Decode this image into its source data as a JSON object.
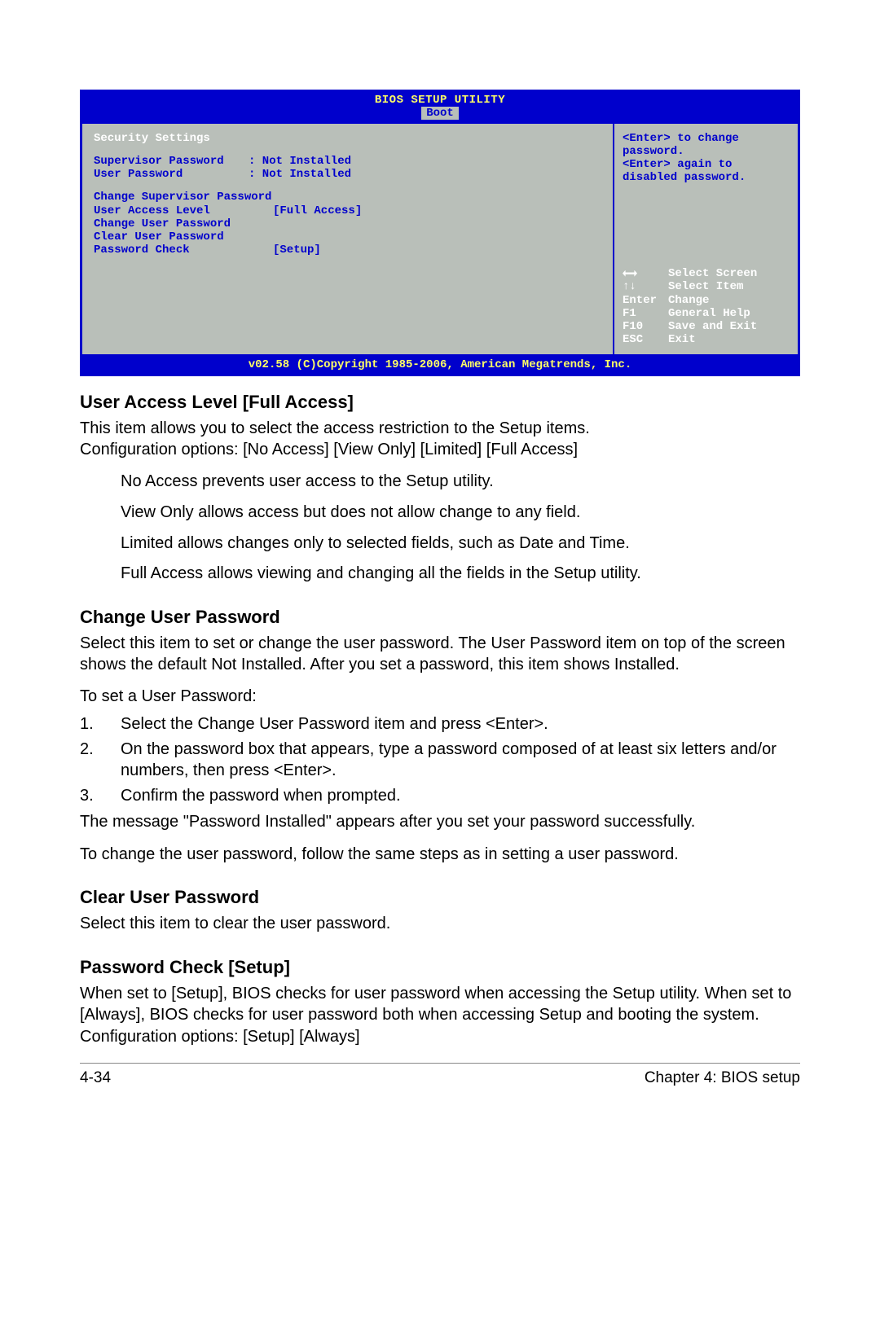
{
  "bios": {
    "title": "BIOS SETUP UTILITY",
    "tab": "Boot",
    "section_header": "Security Settings",
    "status": [
      {
        "label": "Supervisor Password",
        "value": ": Not Installed"
      },
      {
        "label": "User Password",
        "value": ": Not Installed"
      }
    ],
    "items": [
      {
        "label": "Change Supervisor Password",
        "value": ""
      },
      {
        "label": "User Access Level",
        "value": "[Full Access]"
      },
      {
        "label": "Change User Password",
        "value": ""
      },
      {
        "label": "Clear User Password",
        "value": ""
      },
      {
        "label": "Password Check",
        "value": "[Setup]"
      }
    ],
    "help_top": [
      "<Enter> to change",
      "password.",
      "<Enter> again to",
      "disabled password."
    ],
    "help_bottom": [
      {
        "key": "←→",
        "text": "Select Screen"
      },
      {
        "key": "↑↓",
        "text": "Select Item"
      },
      {
        "key": "Enter",
        "text": "Change"
      },
      {
        "key": "F1",
        "text": "General Help"
      },
      {
        "key": "F10",
        "text": "Save and Exit"
      },
      {
        "key": "ESC",
        "text": "Exit"
      }
    ],
    "footer": "v02.58 (C)Copyright 1985-2006, American Megatrends, Inc."
  },
  "doc": {
    "s1_h": "User Access Level [Full Access]",
    "s1_p1": "This item allows you to select the access restriction to the Setup items.",
    "s1_p2": "Configuration options: [No Access] [View Only] [Limited] [Full Access]",
    "s1_li1": "No Access prevents user access to the Setup utility.",
    "s1_li2": "View Only allows access but does not allow change to any field.",
    "s1_li3": "Limited allows changes only to selected fields, such as Date and Time.",
    "s1_li4": "Full Access allows viewing and changing all the fields in the Setup utility.",
    "s2_h": "Change User Password",
    "s2_p1": "Select this item to set or change the user password. The User Password item on top of the screen shows the default Not Installed. After you set a password, this item shows Installed.",
    "s2_p2": "To set a User Password:",
    "s2_steps": [
      "Select the Change User Password item and press <Enter>.",
      "On the password box that appears, type a password composed of at least six letters and/or numbers, then press <Enter>.",
      "Confirm the password when prompted."
    ],
    "s2_p3": "The message \"Password Installed\" appears after you set your password successfully.",
    "s2_p4": "To change the user password, follow the same steps as in setting a user password.",
    "s3_h": "Clear User Password",
    "s3_p1": "Select this item to clear the user password.",
    "s4_h": "Password Check [Setup]",
    "s4_p1": "When set to [Setup], BIOS checks for user password when accessing the Setup utility. When set to [Always], BIOS checks for user password both when accessing Setup and booting the system.",
    "s4_p2": "Configuration options: [Setup] [Always]"
  },
  "footer": {
    "left": "4-34",
    "right": "Chapter 4: BIOS setup"
  }
}
